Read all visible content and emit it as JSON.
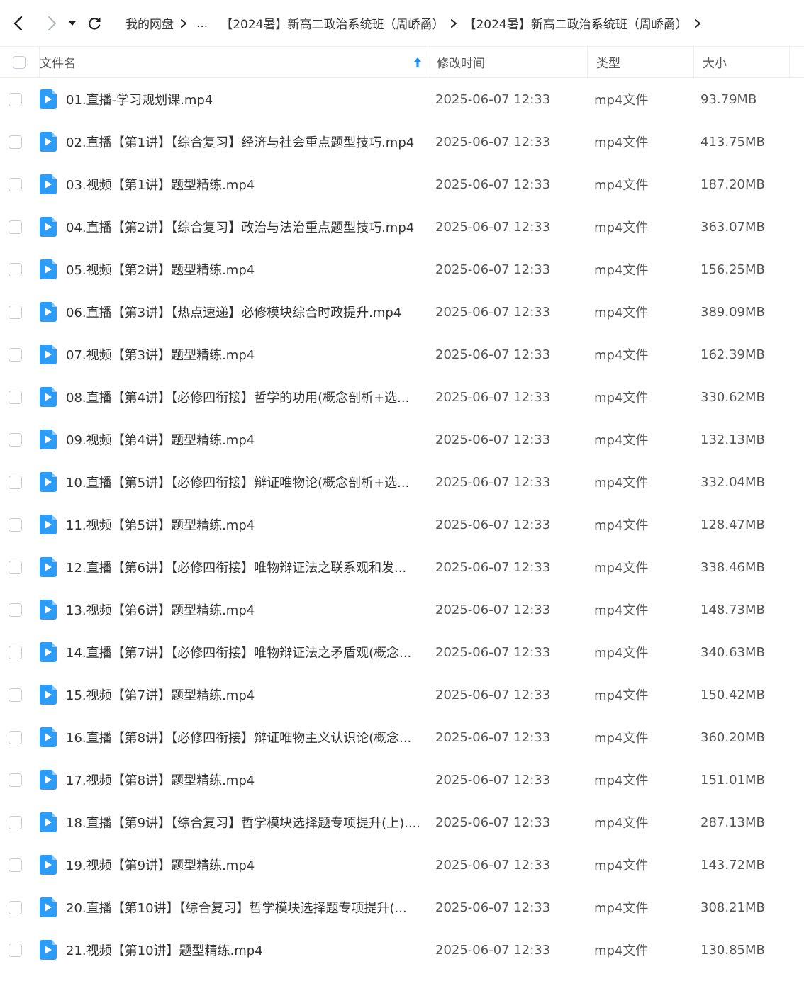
{
  "breadcrumb": {
    "root": "我的网盘",
    "ellipsis": "...",
    "folder1": "【2024暑】新高二政治系统班（周峤矞）",
    "folder2": "【2024暑】新高二政治系统班（周峤矞）"
  },
  "header": {
    "name": "文件名",
    "time": "修改时间",
    "type": "类型",
    "size": "大小"
  },
  "colors": {
    "accent": "#1e8dff",
    "icon_blue": "#2b9cf7"
  },
  "files": [
    {
      "name": "01.直播-学习规划课.mp4",
      "time": "2025-06-07 12:33",
      "type": "mp4文件",
      "size": "93.79MB"
    },
    {
      "name": "02.直播【第1讲】【综合复习】经济与社会重点题型技巧.mp4",
      "time": "2025-06-07 12:33",
      "type": "mp4文件",
      "size": "413.75MB"
    },
    {
      "name": "03.视频【第1讲】题型精练.mp4",
      "time": "2025-06-07 12:33",
      "type": "mp4文件",
      "size": "187.20MB"
    },
    {
      "name": "04.直播【第2讲】【综合复习】政治与法治重点题型技巧.mp4",
      "time": "2025-06-07 12:33",
      "type": "mp4文件",
      "size": "363.07MB"
    },
    {
      "name": "05.视频【第2讲】题型精练.mp4",
      "time": "2025-06-07 12:33",
      "type": "mp4文件",
      "size": "156.25MB"
    },
    {
      "name": "06.直播【第3讲】【热点速递】必修模块综合时政提升.mp4",
      "time": "2025-06-07 12:33",
      "type": "mp4文件",
      "size": "389.09MB"
    },
    {
      "name": "07.视频【第3讲】题型精练.mp4",
      "time": "2025-06-07 12:33",
      "type": "mp4文件",
      "size": "162.39MB"
    },
    {
      "name": "08.直播【第4讲】【必修四衔接】哲学的功用(概念剖析+选...",
      "time": "2025-06-07 12:33",
      "type": "mp4文件",
      "size": "330.62MB"
    },
    {
      "name": "09.视频【第4讲】题型精练.mp4",
      "time": "2025-06-07 12:33",
      "type": "mp4文件",
      "size": "132.13MB"
    },
    {
      "name": "10.直播【第5讲】【必修四衔接】辩证唯物论(概念剖析+选...",
      "time": "2025-06-07 12:33",
      "type": "mp4文件",
      "size": "332.04MB"
    },
    {
      "name": "11.视频【第5讲】题型精练.mp4",
      "time": "2025-06-07 12:33",
      "type": "mp4文件",
      "size": "128.47MB"
    },
    {
      "name": "12.直播【第6讲】【必修四衔接】唯物辩证法之联系观和发...",
      "time": "2025-06-07 12:33",
      "type": "mp4文件",
      "size": "338.46MB"
    },
    {
      "name": "13.视频【第6讲】题型精练.mp4",
      "time": "2025-06-07 12:33",
      "type": "mp4文件",
      "size": "148.73MB"
    },
    {
      "name": "14.直播【第7讲】【必修四衔接】唯物辩证法之矛盾观(概念...",
      "time": "2025-06-07 12:33",
      "type": "mp4文件",
      "size": "340.63MB"
    },
    {
      "name": "15.视频【第7讲】题型精练.mp4",
      "time": "2025-06-07 12:33",
      "type": "mp4文件",
      "size": "150.42MB"
    },
    {
      "name": "16.直播【第8讲】【必修四衔接】辩证唯物主义认识论(概念...",
      "time": "2025-06-07 12:33",
      "type": "mp4文件",
      "size": "360.20MB"
    },
    {
      "name": "17.视频【第8讲】题型精练.mp4",
      "time": "2025-06-07 12:33",
      "type": "mp4文件",
      "size": "151.01MB"
    },
    {
      "name": "18.直播【第9讲】【综合复习】哲学模块选择题专项提升(上)....",
      "time": "2025-06-07 12:33",
      "type": "mp4文件",
      "size": "287.13MB"
    },
    {
      "name": "19.视频【第9讲】题型精练.mp4",
      "time": "2025-06-07 12:33",
      "type": "mp4文件",
      "size": "143.72MB"
    },
    {
      "name": "20.直播【第10讲】【综合复习】哲学模块选择题专项提升(...",
      "time": "2025-06-07 12:33",
      "type": "mp4文件",
      "size": "308.21MB"
    },
    {
      "name": "21.视频【第10讲】题型精练.mp4",
      "time": "2025-06-07 12:33",
      "type": "mp4文件",
      "size": "130.85MB"
    }
  ]
}
